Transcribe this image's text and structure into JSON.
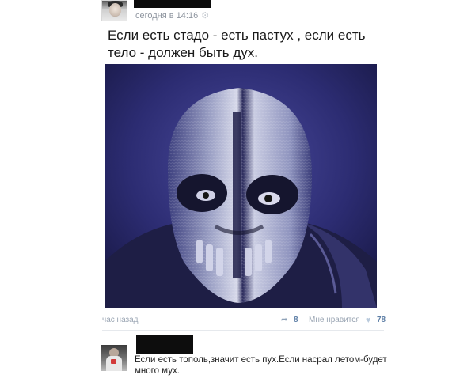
{
  "post": {
    "time": "сегодня в 14:16",
    "icon": "gear-icon",
    "text": "Если есть стадо - есть пастух , если есть тело - должен быть дух.",
    "image_alt": "masked figure",
    "time_ago": "час назад",
    "share_count": "8",
    "like_label": "Мне нравится",
    "like_count": "78"
  },
  "comment": {
    "text": "Если есть тополь,значит есть пух.Если насрал летом-будет много мух."
  },
  "colors": {
    "link_blue": "#5e7fa6",
    "muted": "#9aa5b3",
    "image_bg": "#2a2a66"
  }
}
